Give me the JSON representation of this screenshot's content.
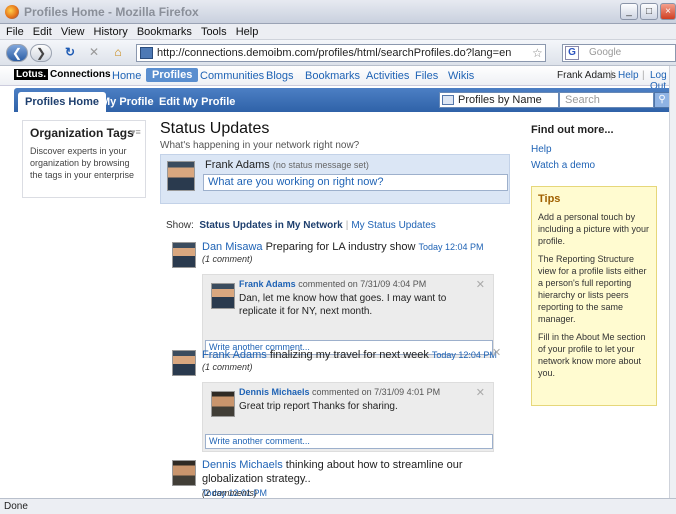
{
  "window": {
    "title": "Profiles Home - Mozilla Firefox"
  },
  "menu": [
    "File",
    "Edit",
    "View",
    "History",
    "Bookmarks",
    "Tools",
    "Help"
  ],
  "nav": {
    "url": "http://connections.demoibm.com/profiles/html/searchProfiles.do?lang=en",
    "search_placeholder": "Google"
  },
  "app": {
    "logo_lotus": "Lotus.",
    "logo_text": "Connections",
    "topnav": [
      "Home",
      "Profiles",
      "Communities",
      "Blogs",
      "Bookmarks",
      "Activities",
      "Files",
      "Wikis"
    ],
    "user": "Frank Adams",
    "help": "Help",
    "logout": "Log Out",
    "tabs": [
      "Profiles Home",
      "My Profile",
      "Edit My Profile"
    ],
    "search_scope": "Profiles by Name",
    "search_placeholder": "Search"
  },
  "org": {
    "title": "Organization Tags",
    "text": "Discover experts in your organization by browsing the tags in your enterprise"
  },
  "status": {
    "title": "Status Updates",
    "subtitle": "What's happening in your network right now?",
    "me": "Frank Adams",
    "me_note": "(no status message set)",
    "input_placeholder": "What are you working on right now?",
    "show_label": "Show:",
    "filter_active": "Status Updates in My Network",
    "filter_other": "My Status Updates",
    "entries": [
      {
        "author": "Dan Misawa",
        "text": "Preparing for LA industry show",
        "time": "Today 12:04 PM",
        "comments": "(1 comment)",
        "c_author": "Frank Adams",
        "c_meta": "commented on 7/31/09 4:04 PM",
        "c_text": "Dan, let me know how that goes. I may want to replicate it for NY, next month.",
        "write": "Write another comment..."
      },
      {
        "author": "Frank Adams",
        "text": "finalizing my travel for next week",
        "time": "Today 12:04 PM",
        "comments": "(1 comment)",
        "c_author": "Dennis Michaels",
        "c_meta": "commented on 7/31/09 4:01 PM",
        "c_text": "Great trip report Thanks for sharing.",
        "write": "Write another comment..."
      },
      {
        "author": "Dennis Michaels",
        "text": "thinking about how to streamline our globalization strategy..",
        "time": "Today 12:01 PM",
        "comments": "(2 comments)"
      }
    ]
  },
  "side": {
    "title": "Find out more...",
    "help": "Help",
    "demo": "Watch a demo",
    "tips_title": "Tips",
    "tips": [
      "Add a personal touch by including a picture with your profile.",
      "The Reporting Structure view for a profile lists either a person's full reporting hierarchy or lists peers reporting to the same manager.",
      "Fill in the About Me section of your profile to let your network know more about you."
    ]
  },
  "statusbar": "Done"
}
